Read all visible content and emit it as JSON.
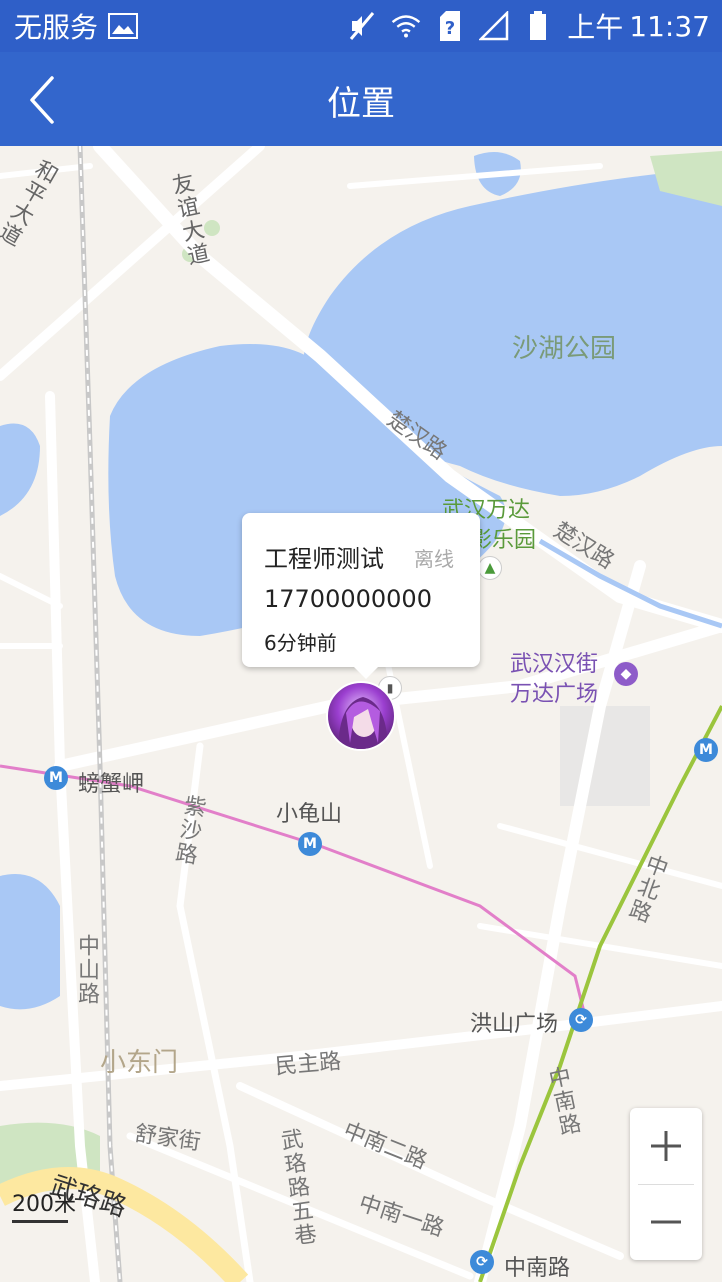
{
  "status_bar": {
    "carrier": "无服务",
    "time_prefix": "上午",
    "time": "11:37"
  },
  "header": {
    "title": "位置"
  },
  "map": {
    "labels": {
      "heping": "和平大道",
      "youyi": "友谊大道",
      "shahu": "沙湖公园",
      "chuhan1": "楚汉路",
      "wanda_park_1": "武汉万达",
      "wanda_park_2": "影乐园",
      "chuhan2": "楚汉路",
      "hanjie_1": "武汉汉街",
      "hanjie_2": "万达广场",
      "pangxiejia": "螃蟹岬",
      "zisha": "紫沙路",
      "xiaoguishan": "小龟山",
      "zhongbei": "中北路",
      "zhongshan": "中山路",
      "hongshan": "洪山广场",
      "xiaodongmen": "小东门",
      "minzhu": "民主路",
      "zhongnan_v": "中南路",
      "shujia": "舒家街",
      "wuluo5": "武珞路五巷",
      "zhongnan2": "中南二路",
      "wuluo": "武珞路",
      "zhongnan1": "中南一路",
      "zhongnan_station": "中南路"
    },
    "scale": "200米"
  },
  "popup": {
    "name": "工程师测试",
    "status": "离线",
    "phone": "17700000000",
    "time": "6分钟前"
  },
  "zoom": {
    "in_label": "+",
    "out_label": "−"
  },
  "colors": {
    "header": "#3366cc",
    "water": "#a9c8f5",
    "road": "#ffffff",
    "metro_pink": "#e27fc9",
    "metro_green": "#9bc53d"
  }
}
